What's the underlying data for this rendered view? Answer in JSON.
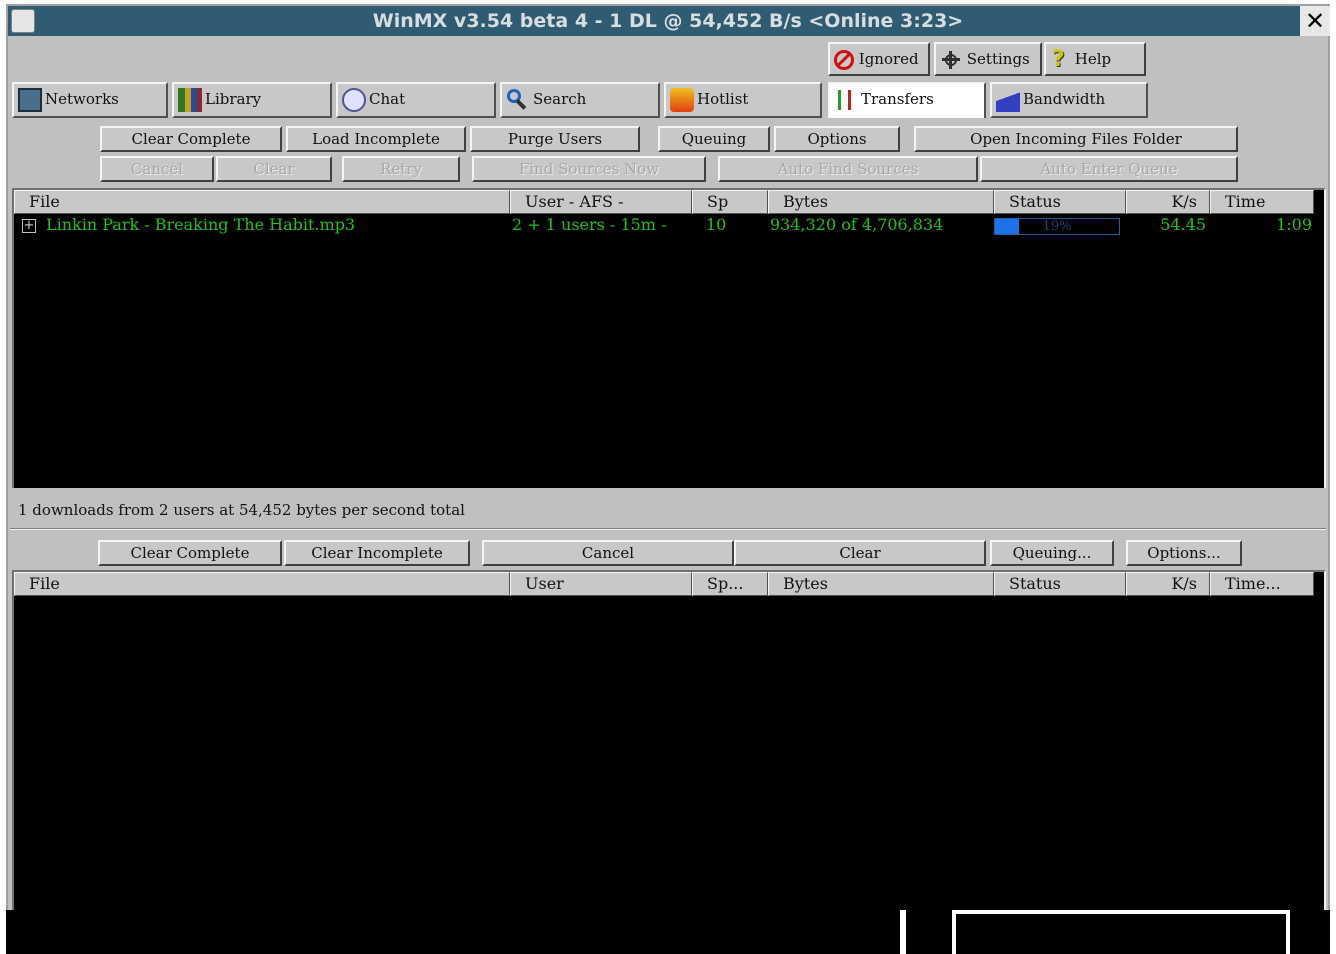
{
  "window": {
    "title": "WinMX v3.54 beta 4  -  1 DL @ 54,452 B/s     <Online 3:23>",
    "close_glyph": "✕"
  },
  "top_buttons": {
    "ignored": "Ignored",
    "settings": "Settings",
    "help": "Help"
  },
  "tabs": [
    {
      "label": "Networks",
      "icon": "networks-icon"
    },
    {
      "label": "Library",
      "icon": "library-icon"
    },
    {
      "label": "Chat",
      "icon": "chat-icon"
    },
    {
      "label": "Search",
      "icon": "search-icon"
    },
    {
      "label": "Hotlist",
      "icon": "hotlist-icon"
    },
    {
      "label": "Transfers",
      "icon": "transfers-icon",
      "active": true
    },
    {
      "label": "Bandwidth",
      "icon": "bandwidth-icon"
    }
  ],
  "downloads": {
    "toolbar_row1": {
      "clear_complete": "Clear Complete",
      "load_incomplete": "Load Incomplete",
      "purge_users": "Purge Users",
      "queuing": "Queuing",
      "options": "Options",
      "open_folder": "Open Incoming Files Folder"
    },
    "toolbar_row2": {
      "cancel": "Cancel",
      "clear": "Clear",
      "retry": "Retry",
      "find_sources": "Find Sources Now",
      "auto_find": "Auto Find Sources",
      "auto_enter": "Auto Enter Queue"
    },
    "columns": {
      "file": "File",
      "user": "User  -  AFS  -",
      "sp": "Sp",
      "bytes": "Bytes",
      "status": "Status",
      "ks": "K/s",
      "time": "Time"
    },
    "rows": [
      {
        "file": "Linkin Park - Breaking The Habit.mp3",
        "user": "2 + 1 users  -  15m  -",
        "sp": "10",
        "bytes": "934,320 of 4,706,834",
        "status": "19%",
        "progress": 0.19,
        "ks": "54.45",
        "time": "1:09"
      }
    ],
    "summary": "1 downloads from 2 users at 54,452 bytes per second total"
  },
  "uploads": {
    "toolbar": {
      "clear_complete": "Clear Complete",
      "clear_incomplete": "Clear Incomplete",
      "cancel": "Cancel",
      "clear": "Clear",
      "queuing": "Queuing...",
      "options": "Options..."
    },
    "columns": {
      "file": "File",
      "user": "User",
      "sp": "Sp...",
      "bytes": "Bytes",
      "status": "Status",
      "ks": "K/s",
      "time": "Time..."
    }
  },
  "colors": {
    "title_bg": "#2f5c73",
    "list_bg": "#000000",
    "list_text": "#1fc31f",
    "progress": "#1a73e8"
  }
}
